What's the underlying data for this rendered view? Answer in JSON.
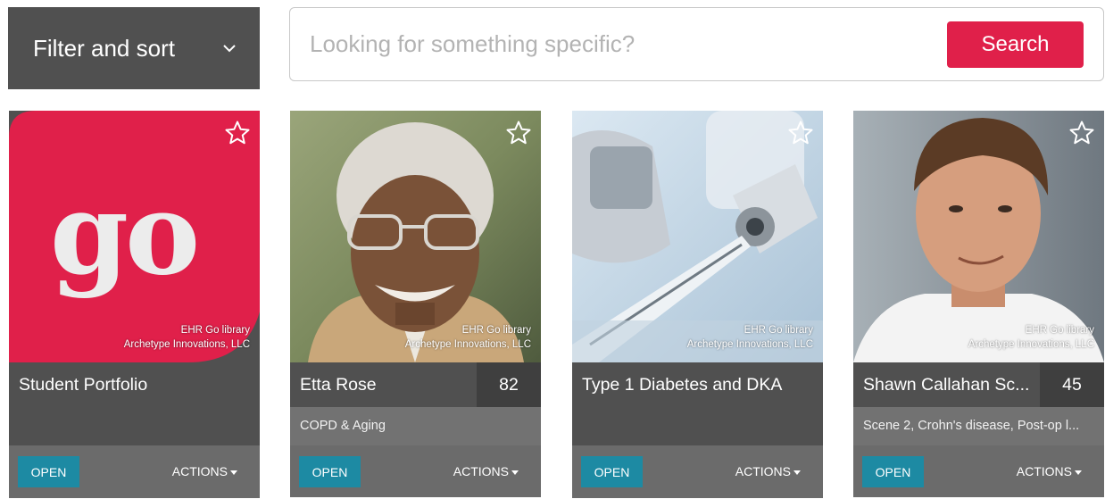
{
  "filter": {
    "label": "Filter and sort"
  },
  "search": {
    "placeholder": "Looking for something specific?",
    "button_label": "Search"
  },
  "cards": [
    {
      "title": "Student Portfolio",
      "count": "",
      "subtitle": "",
      "credit_line1": "EHR Go library",
      "credit_line2": "Archetype Innovations, LLC",
      "open_label": "OPEN",
      "actions_label": "ACTIONS",
      "image_text": "go"
    },
    {
      "title": "Etta Rose",
      "count": "82",
      "subtitle": "COPD & Aging",
      "credit_line1": "EHR Go library",
      "credit_line2": "Archetype Innovations, LLC",
      "open_label": "OPEN",
      "actions_label": "ACTIONS"
    },
    {
      "title": "Type 1 Diabetes and DKA",
      "count": "",
      "subtitle": "",
      "credit_line1": "EHR Go library",
      "credit_line2": "Archetype Innovations, LLC",
      "open_label": "OPEN",
      "actions_label": "ACTIONS"
    },
    {
      "title": "Shawn Callahan Sc...",
      "count": "45",
      "subtitle": "Scene 2, Crohn's disease, Post-op l...",
      "credit_line1": "EHR Go library",
      "credit_line2": "Archetype Innovations, LLC",
      "open_label": "OPEN",
      "actions_label": "ACTIONS"
    }
  ],
  "colors": {
    "accent": "#e0204a",
    "open_button": "#1d8aa3",
    "card_dark": "#505050"
  },
  "icons": {
    "filter": "chevron-down-icon",
    "favorite": "star-outline-icon",
    "actions": "caret-down-icon"
  }
}
